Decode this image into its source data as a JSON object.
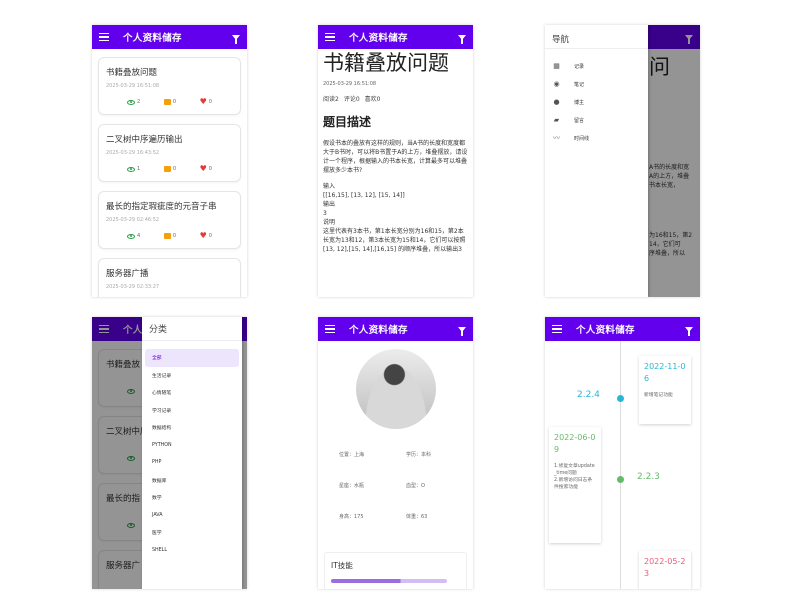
{
  "app": {
    "title": "个人资料储存"
  },
  "list_screen": {
    "cards": [
      {
        "title": "书籍叠放问题",
        "date": "2025-03-29 16:51:08",
        "views": "2",
        "comments": "0",
        "likes": "0"
      },
      {
        "title": "二叉树中序遍历输出",
        "date": "2025-03-29 16:43:52",
        "views": "1",
        "comments": "0",
        "likes": "0"
      },
      {
        "title": "最长的指定瑕疵度的元音子串",
        "date": "2025-03-29 02:46:52",
        "views": "4",
        "comments": "0",
        "likes": "0"
      },
      {
        "title": "服务器广播",
        "date": "2025-03-29 02:33:27",
        "views": "",
        "comments": "",
        "likes": ""
      }
    ]
  },
  "article_screen": {
    "title": "书籍叠放问题",
    "date": "2025-03-29 16:51:08",
    "reads": "阅读2",
    "comments": "评论0",
    "likes": "喜欢0",
    "section": "题目描述",
    "paragraph": "假设书本的叠放有这样的规则，当A书的长度和宽度都大于B书时，可以将B书置于A的上方，堆叠摆放，请设计一个程序，根据输入的书本长宽，计算最多可以堆叠摆放多少本书?",
    "lines": [
      "输入",
      "[[16,15], [13, 12], [15, 14]]",
      "输出",
      "3",
      "说明",
      "这里代表有3本书，第1本长宽分别为16和15，第2本长宽为13和12，第3本长宽为15和14，它们可以按照 [13, 12],[15, 14],[16,15] 的顺序堆叠，所以输出3"
    ]
  },
  "nav_drawer": {
    "header": "导航",
    "items": [
      {
        "label": "记录",
        "icon": "dashboard-icon"
      },
      {
        "label": "笔记",
        "icon": "account-circle-icon"
      },
      {
        "label": "博主",
        "icon": "person-icon"
      },
      {
        "label": "留言",
        "icon": "forum-icon"
      },
      {
        "label": "时间线",
        "icon": "timeline-icon"
      }
    ],
    "bg_title": "问",
    "bg_snippets": [
      "A书的长度和宽",
      "A的上方，堆叠",
      "书本长宽，",
      "为16和15，第2",
      "14，它们可",
      "序堆叠，所以"
    ]
  },
  "category_drawer": {
    "header": "分类",
    "items": [
      "全部",
      "生活记录",
      "心情随笔",
      "学习记录",
      "数据结构",
      "PYTHON",
      "PHP",
      "数据库",
      "数学",
      "JAVA",
      "医学",
      "SHELL"
    ],
    "active_index": 0,
    "bg_titles": [
      "书籍叠放",
      "二叉树中序",
      "最长的指",
      "服务器广"
    ]
  },
  "profile_screen": {
    "fields": [
      {
        "label": "位置：上海"
      },
      {
        "label": "学历：本科"
      },
      {
        "label": "星座：水瓶"
      },
      {
        "label": "血型：O"
      },
      {
        "label": "身高：175"
      },
      {
        "label": "体重：63"
      }
    ],
    "skills_title": "IT技能",
    "skill_progress": 0.6
  },
  "timeline_screen": {
    "entries": [
      {
        "version": "2.2.4",
        "date": "2022-11-06",
        "date_display": "2022-11-0\n6",
        "text": "新增笔记功能",
        "color": "#29b6d6"
      },
      {
        "version": "2.2.3",
        "date": "2022-06-09",
        "date_display": "2022-06-0\n9",
        "text": "1.修复文章update_time问题\n2.新增访问日志条件搜索功能",
        "color": "#66bb6a"
      },
      {
        "version": "",
        "date": "2022-05-23",
        "date_display": "2022-05-2\n3",
        "text": "",
        "color": "#ec5a7a"
      }
    ]
  },
  "colors": {
    "primary": "#6200ee",
    "view": "#2e9d4a",
    "comment": "#f5a00a",
    "like": "#e53935"
  }
}
